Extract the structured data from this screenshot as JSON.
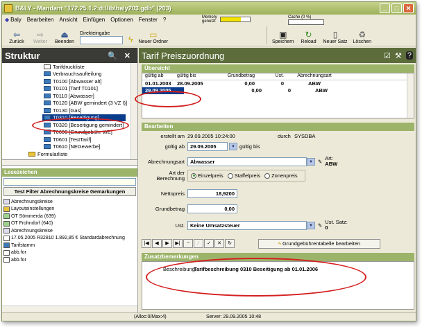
{
  "window": {
    "title": "B&LY - Mandant \"172.25.1.2:d:\\lib\\baly203.gdb\" (203)"
  },
  "menu": [
    "Baly",
    "Bearbeiten",
    "Ansicht",
    "Einfügen",
    "Optionen",
    "Fenster",
    "?"
  ],
  "indicators": {
    "memory_label": "Memory genutzt",
    "cache_label": "Cache (0 %)"
  },
  "toolbar": {
    "back": "Zurück",
    "forward": "Weiter",
    "quit": "Beenden",
    "direkt_label": "Direkteingabe",
    "new_folder": "Neuer Ordner",
    "save": "Speichern",
    "reload": "Reload",
    "new_record": "Neuer Satz",
    "delete": "Löschen"
  },
  "struktur": {
    "title": "Struktur",
    "items": [
      "Tarifdruckliste",
      "Verbrauchsaufteilung",
      "T0100 [Abwasser alt]",
      "T0101 [Tarif T0101]",
      "T0110 [Abwasser]",
      "T0120 [ABW gemindert (3 VZ I)]",
      "T0130 [Gas]",
      "T0310 [Beseitigung]",
      "T0320 [Beseitigung gemindert]",
      "T0600 [Grundgebühr WE]",
      "T0601 [TestTarif]",
      "T0610 [NEGewerbe]",
      "Formularliste"
    ]
  },
  "lesezeichen": {
    "title": "Lesezeichen",
    "filter_button": "Test Filter Abrechnungskreise Gemarkungen",
    "items": [
      "Abrechnungskreise",
      "Layouteinstellungen",
      "OT Sömmerda (639)",
      "OT Frohndorf (640)",
      "Abrechnungskreise",
      "17.05.2005 R32810 1.892,85 € Standardabrechnung",
      "Tarifstamm",
      "abb.for",
      "abb.for"
    ]
  },
  "main": {
    "title": "Tarif Preiszuordnung",
    "uebersicht": {
      "title": "Übersicht",
      "headers": [
        "gültig ab",
        "gültig bis",
        "Grundbetrag",
        "Ust.",
        "Abrechnungsart"
      ],
      "rows": [
        [
          "01.01.2003",
          "28.09.2005",
          "0,00",
          "0",
          "ABW"
        ],
        [
          "29.09.2005",
          "",
          "0,00",
          "0",
          "ABW"
        ]
      ]
    },
    "bearbeiten": {
      "title": "Bearbeiten",
      "erstellt_label": "erstellt am",
      "erstellt_value": "29.09.2005 10:24:00",
      "durch_label": "durch",
      "durch_value": "SYSDBA",
      "gueltig_ab_label": "gültig ab",
      "gueltig_ab_value": "29.09.2005",
      "gueltig_bis_label": "gültig bis",
      "abrechnungsart_label": "Abrechnungsart",
      "abrechnungsart_value": "Abwasser",
      "art_label": "Art:",
      "art_value": "ABW",
      "berechnung_label": "Art der Berechnung",
      "radio_options": [
        "Einzelpreis",
        "Staffelpreis",
        "Zonenpreis"
      ],
      "nettopreis_label": "Nettopreis",
      "nettopreis_value": "18,9200",
      "grundbetrag_label": "Grundbetrag",
      "grundbetrag_value": "0,00",
      "ust_label": "Ust.",
      "ust_value": "Keine Umsatzsteuer",
      "ust_satz_label": "Ust. Satz:",
      "ust_satz_value": "0"
    },
    "nav_buttons": [
      "|◀",
      "◀",
      "▶",
      "▶|",
      "−",
      "⁄",
      "✓",
      "✕",
      "↻"
    ],
    "grund_button": "Grundgebührentabelle bearbeiten",
    "zusatz": {
      "title": "Zusatzbemerkungen",
      "beschreibung_label": "Beschreibung",
      "beschreibung_value": "Tarifbeschreibung 0310 Beseitigung ab 01.01.2006"
    }
  },
  "status": {
    "alloc": "(Alloc:0/Max:4)",
    "server": "Server: 29.09.2005 10:48"
  },
  "colors": {
    "accent": "#9cb46a",
    "header_dark": "#3a3a36",
    "selection": "#0a3c8c",
    "annotation": "#d42020"
  }
}
